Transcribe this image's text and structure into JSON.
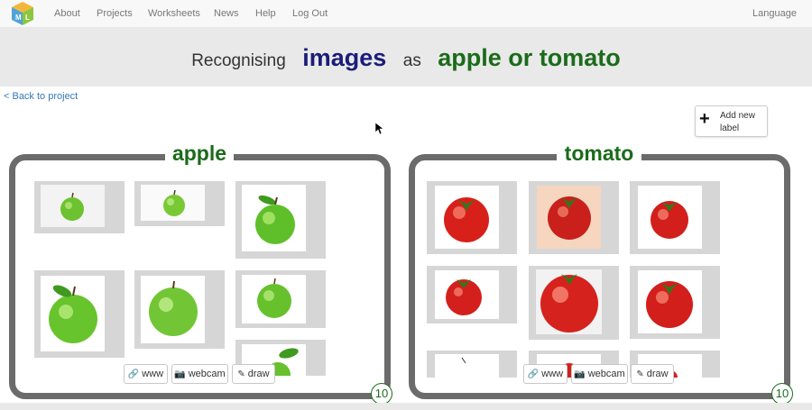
{
  "nav": {
    "logo_icon": "machine-learning-for-kids-cube-logo",
    "items": [
      "About",
      "Projects",
      "Worksheets",
      "News",
      "Help",
      "Log Out"
    ],
    "language": "Language"
  },
  "title": {
    "prefix": "Recognising",
    "type": "images",
    "middle": "as",
    "labels": "apple or tomato",
    "colors": {
      "type": "#1c1c7a",
      "labels": "#1b6b1b"
    }
  },
  "back_link": "< Back to project",
  "add_label": {
    "icon": "plus-icon",
    "text": "Add new label"
  },
  "buckets": [
    {
      "label": "apple",
      "count": "10",
      "images": [
        "green-apple-photo",
        "green-apple-photo",
        "green-apple-with-leaf-photo",
        "green-apple-with-leaf-photo",
        "green-apple-photo",
        "green-apple-photo",
        "green-apple-leaf-photo"
      ],
      "tools": [
        {
          "icon": "link-icon",
          "label": "www"
        },
        {
          "icon": "camera-icon",
          "label": "webcam"
        },
        {
          "icon": "pencil-icon",
          "label": "draw"
        }
      ]
    },
    {
      "label": "tomato",
      "count": "10",
      "images": [
        "red-tomato-photo",
        "red-tomato-photo",
        "red-tomato-photo",
        "red-tomato-photo",
        "red-tomato-photo",
        "red-tomato-photo",
        "red-tomato-photo",
        "red-tomato-photo",
        "red-tomato-photo"
      ],
      "tools": [
        {
          "icon": "link-icon",
          "label": "www"
        },
        {
          "icon": "camera-icon",
          "label": "webcam"
        },
        {
          "icon": "pencil-icon",
          "label": "draw"
        }
      ]
    }
  ]
}
